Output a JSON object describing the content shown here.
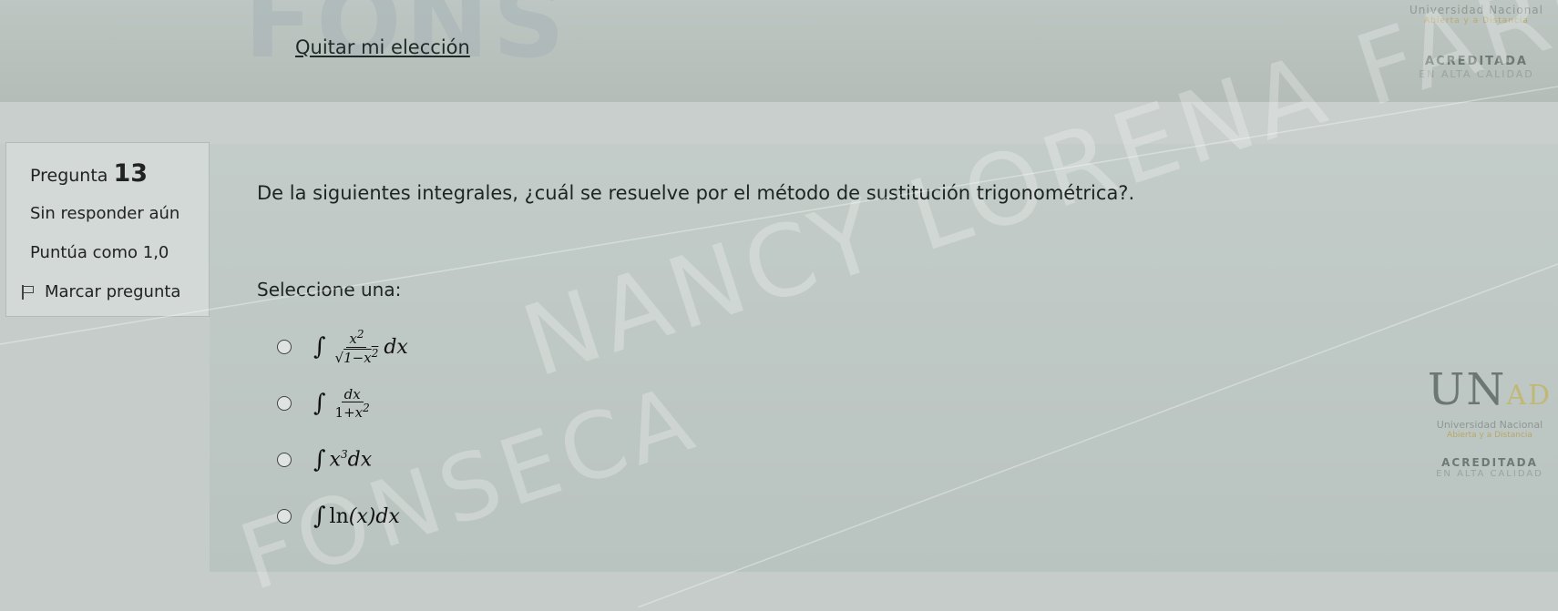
{
  "header": {
    "faded_title": "FONS",
    "clear_choice": "Quitar mi elección"
  },
  "question_info": {
    "label": "Pregunta",
    "number": "13",
    "state": "Sin responder aún",
    "grade": "Puntúa como 1,0",
    "flag_label": "Marcar pregunta",
    "flag_icon": "flag-icon"
  },
  "question": {
    "text": "De la siguientes integrales, ¿cuál se resuelve por el método de sustitución trigonométrica?.",
    "prompt": "Seleccione una:",
    "options": [
      "∫ x²/√(1−x²) dx",
      "∫ dx/(1+x²)",
      "∫ x³dx",
      "∫ ln(x)dx"
    ]
  },
  "watermark": {
    "line1": "NANCY LORENA FARFAN",
    "line2": "FONSECA"
  },
  "branding": {
    "university": "Universidad Nacional",
    "tagline": "Abierta y a Distancia",
    "accredited": "ACREDITADA",
    "quality": "EN ALTA CALIDAD",
    "logo_mark": "UN",
    "logo_mark_suffix": "AD"
  },
  "colors": {
    "background": "#c5ccca",
    "panel": "#d3d9d7",
    "text": "#1e2422",
    "accent_gold": "#c3b778"
  }
}
